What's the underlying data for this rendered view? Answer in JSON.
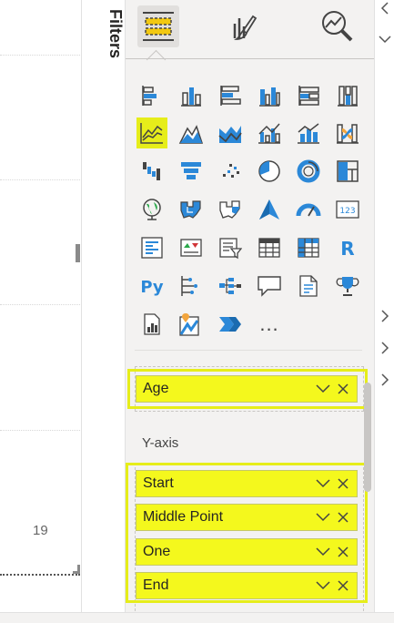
{
  "canvas": {
    "axis_value": "19"
  },
  "filters": {
    "label": "Filters"
  },
  "viz_tabs": [
    {
      "name": "build-visual-tab",
      "icon": "build-visual-icon",
      "selected": true
    },
    {
      "name": "format-visual-tab",
      "icon": "paint-brush-icon",
      "selected": false
    },
    {
      "name": "analytics-tab",
      "icon": "magnifier-chart-icon",
      "selected": false
    }
  ],
  "visual_icons": [
    "stacked-bar-chart-icon",
    "stacked-column-chart-icon",
    "clustered-bar-chart-icon",
    "clustered-column-chart-icon",
    "100-stacked-bar-chart-icon",
    "100-stacked-column-chart-icon",
    "line-chart-icon",
    "area-chart-icon",
    "stacked-area-chart-icon",
    "line-clustered-column-chart-icon",
    "line-stacked-column-chart-icon",
    "ribbon-chart-icon",
    "waterfall-chart-icon",
    "funnel-chart-icon",
    "scatter-chart-icon",
    "pie-chart-icon",
    "donut-chart-icon",
    "treemap-icon",
    "map-icon",
    "filled-map-icon",
    "shape-map-icon",
    "azure-map-icon",
    "gauge-icon",
    "card-icon",
    "multi-row-card-icon",
    "kpi-icon",
    "slicer-icon",
    "table-icon",
    "matrix-icon",
    "r-visual-icon",
    "python-visual-icon",
    "key-influencers-icon",
    "decomposition-tree-icon",
    "qa-icon",
    "smart-narrative-icon",
    "trophy-goals-icon",
    "paginated-report-icon",
    "arcgis-map-icon",
    "power-automate-icon",
    "more-visuals-icon"
  ],
  "selected_visual": "line-chart-icon",
  "more_label": "...",
  "wells": {
    "x_axis_fields": [
      {
        "label": "Age"
      }
    ],
    "y_axis_label": "Y-axis",
    "y_axis_fields": [
      {
        "label": "Start"
      },
      {
        "label": "Middle Point"
      },
      {
        "label": "One"
      },
      {
        "label": "End"
      }
    ]
  },
  "colors": {
    "highlight": "#e6ed1a",
    "field_pill": "#f4f81d",
    "panel_bg": "#f3f2f1",
    "accent_blue": "#2b88d8"
  }
}
